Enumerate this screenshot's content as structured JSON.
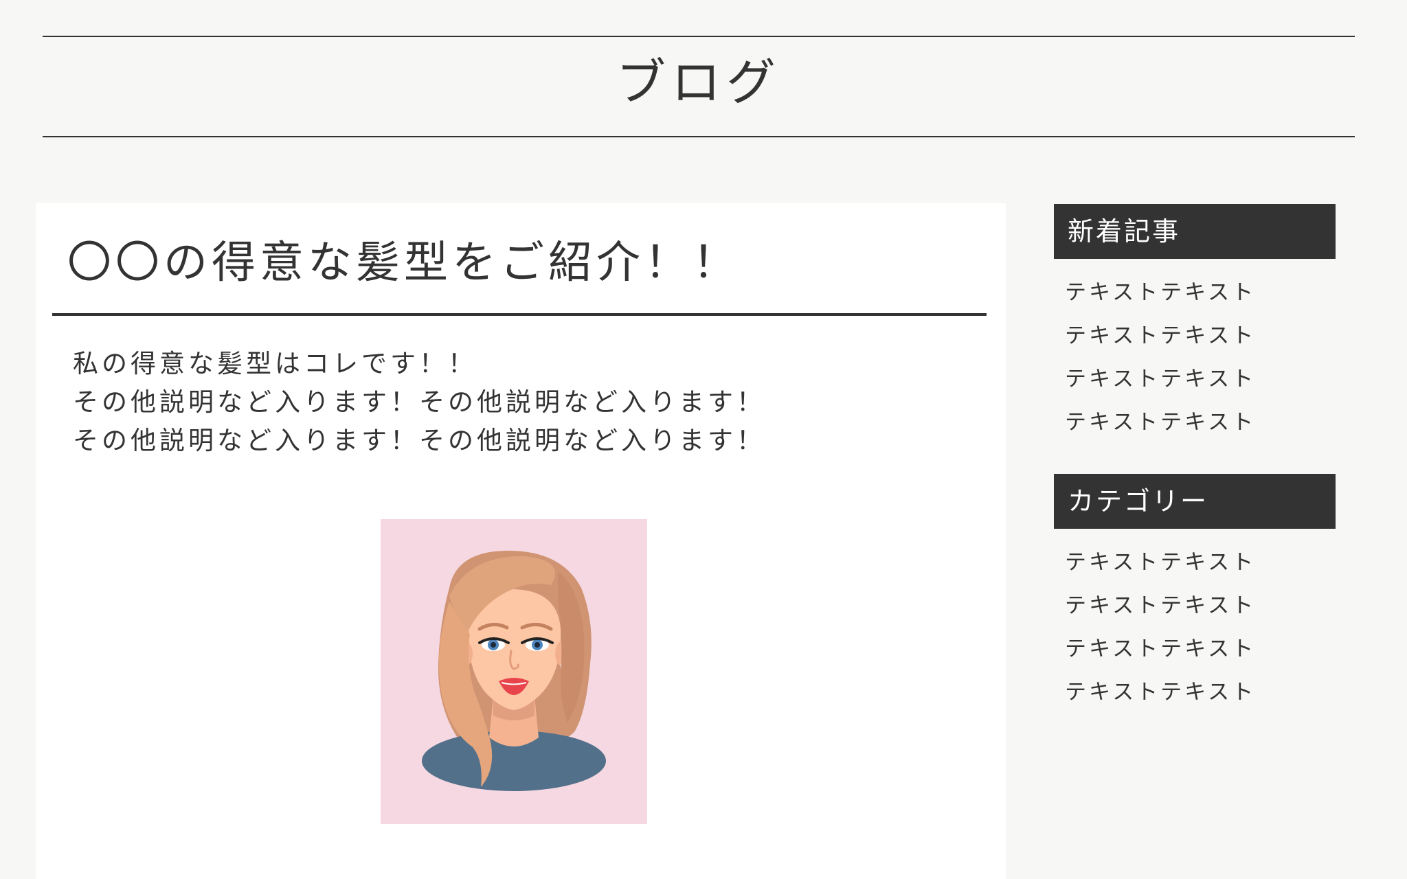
{
  "header": {
    "title": "ブログ"
  },
  "article": {
    "title": "〇〇の得意な髪型をご紹介！！",
    "body": [
      "私の得意な髪型はコレです！！",
      "その他説明など入ります！その他説明など入ります！",
      "その他説明など入ります！その他説明など入ります！"
    ],
    "image": {
      "icon": "woman-portrait-illustration",
      "background_color": "#f6d8e2"
    }
  },
  "sidebar": {
    "new_posts": {
      "heading": "新着記事",
      "items": [
        "テキストテキスト",
        "テキストテキスト",
        "テキストテキスト",
        "テキストテキスト"
      ]
    },
    "categories": {
      "heading": "カテゴリー",
      "items": [
        "テキストテキスト",
        "テキストテキスト",
        "テキストテキスト",
        "テキストテキスト"
      ]
    }
  },
  "colors": {
    "background": "#f7f7f5",
    "text": "#333333",
    "panel": "#ffffff",
    "widget_header_bg": "#333333"
  }
}
